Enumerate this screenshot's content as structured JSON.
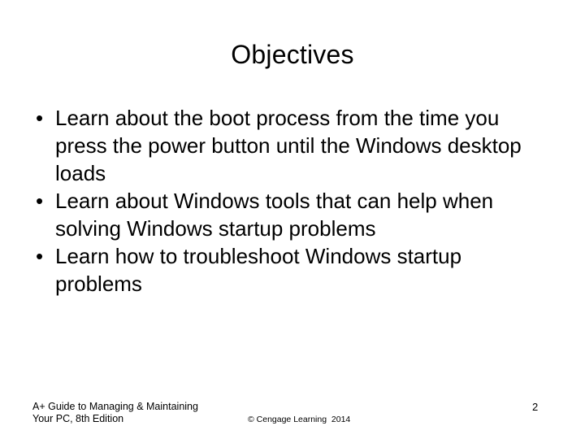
{
  "slide": {
    "title": "Objectives",
    "page_number": "2",
    "background_color": "#ffffff",
    "text_color": "#000000"
  },
  "body": {
    "bullet_marker": "•",
    "items": [
      {
        "text": "Learn about the boot process from the time you press the power button until the Windows desktop loads"
      },
      {
        "text": "Learn about Windows tools that can help when solving Windows startup problems"
      },
      {
        "text": "Learn how to troubleshoot Windows startup problems"
      }
    ]
  },
  "footer": {
    "book_title_line1": "A+ Guide to Managing & Maintaining",
    "book_title_line2": "Your PC, 8th Edition",
    "copyright": "© Cengage Learning  2014"
  }
}
